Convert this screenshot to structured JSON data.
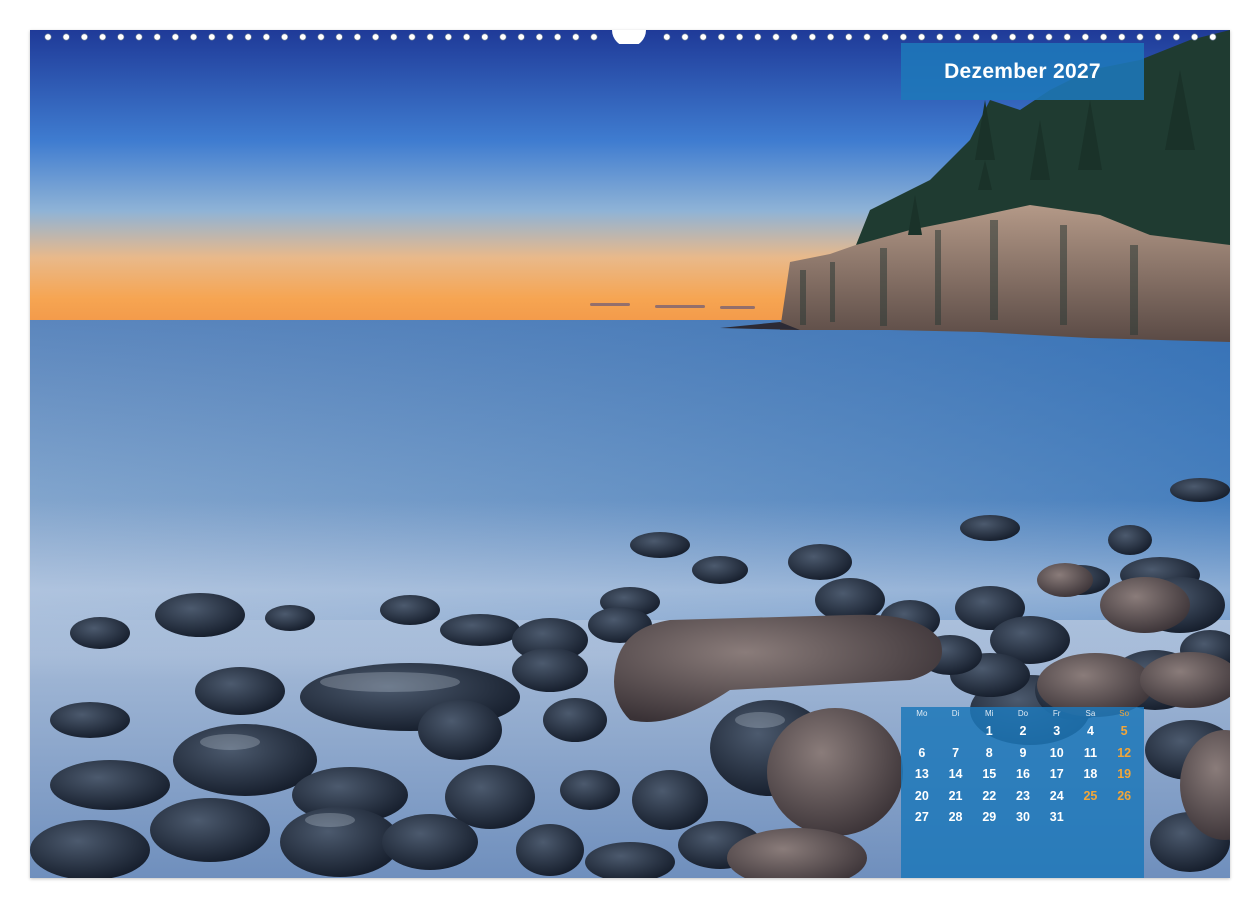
{
  "month_title": "Dezember 2027",
  "calendar": {
    "weekdays": [
      "Mo",
      "Di",
      "Mi",
      "Do",
      "Fr",
      "Sa",
      "So"
    ],
    "first_weekday_index": 2,
    "days_in_month": 31,
    "highlighted_days": [
      5,
      12,
      19,
      25,
      26
    ],
    "highlight_color": "#f2a63a",
    "text_color": "#ffffff",
    "box_color": "#1e78b9"
  },
  "photo": {
    "sky_top": "#233f9e",
    "sky_mid": "#4f9ad8",
    "horizon_glow": "#f6a552",
    "sea": "#3d73b3",
    "stones": "#1c2a3c"
  }
}
